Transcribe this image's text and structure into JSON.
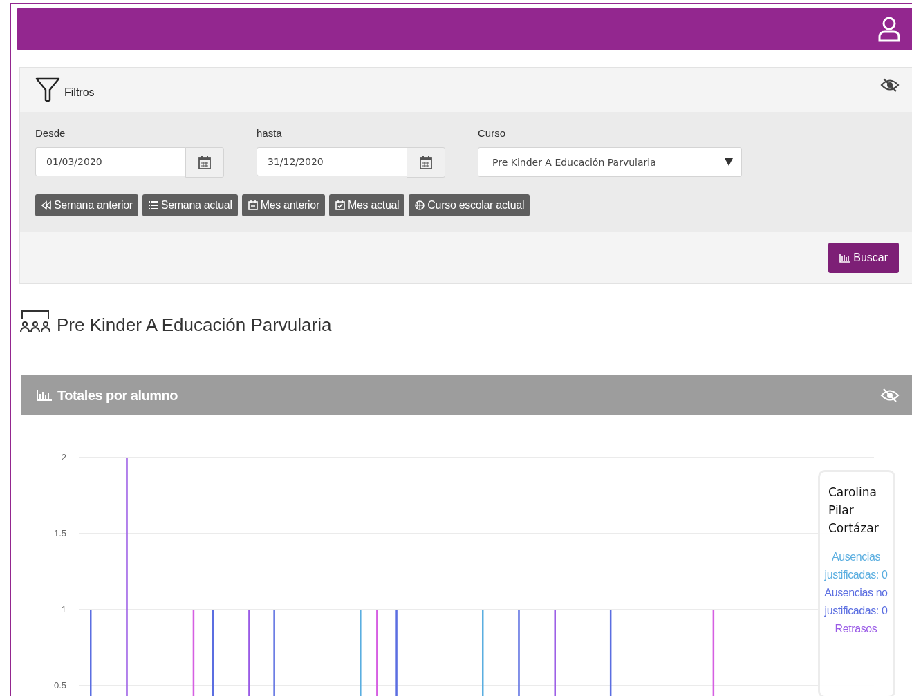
{
  "filters": {
    "title": "Filtros",
    "fields": [
      {
        "label": "Desde",
        "value": "01/03/2020",
        "kind": "date"
      },
      {
        "label": "hasta",
        "value": "31/12/2020",
        "kind": "date"
      },
      {
        "label": "Curso",
        "value": "Pre Kinder A Educación Parvularia",
        "kind": "select"
      }
    ],
    "quick_buttons": [
      "Semana anterior",
      "Semana actual",
      "Mes anterior",
      "Mes actual",
      "Curso escolar actual"
    ],
    "search_button": "Buscar"
  },
  "course_title": "Pre Kinder A Educación Parvularia",
  "chart_panel": {
    "title": "Totales por alumno",
    "chart_data": {
      "type": "bar",
      "grid": true,
      "ylim": [
        0,
        2
      ],
      "yticks": [
        {
          "value": 0.5,
          "label": "0.5"
        },
        {
          "value": 1,
          "label": "1"
        },
        {
          "value": 1.5,
          "label": "1.5"
        },
        {
          "value": 2,
          "label": "2"
        }
      ],
      "series": [
        {
          "name": "Ausencias justificadas",
          "color": "#5aaee0",
          "values": [
            0,
            0,
            0,
            0,
            0,
            0,
            0,
            0,
            0,
            1,
            0,
            0,
            0,
            1,
            0,
            0,
            0,
            0,
            0,
            0,
            0,
            0,
            0,
            0,
            0,
            0
          ]
        },
        {
          "name": "Ausencias no justificadas",
          "color": "#5b6ee1",
          "values": [
            1,
            0,
            0,
            0,
            1,
            0,
            1,
            0,
            0,
            0,
            1,
            0,
            0,
            0,
            1,
            0,
            0,
            1,
            0,
            0,
            0,
            0,
            0,
            0,
            0,
            0
          ]
        },
        {
          "name": "Retrasos",
          "color": "#9a5be6",
          "values": [
            0,
            2,
            0,
            0,
            0,
            1,
            0,
            0,
            0,
            0,
            0,
            0,
            0,
            0,
            0,
            1,
            0,
            0,
            0,
            0,
            0,
            0,
            0,
            0,
            0,
            0
          ]
        },
        {
          "color": "#d65fe2",
          "values": [
            0,
            0,
            0,
            1,
            0,
            0,
            0,
            0,
            0,
            1,
            0,
            0,
            0,
            0,
            0,
            0,
            0,
            0,
            0,
            0,
            1,
            0,
            0,
            0,
            0,
            0
          ]
        }
      ]
    },
    "tooltip": {
      "name": "Carolina Pilar Cortázar",
      "values": [
        ": 0",
        ": 0"
      ]
    }
  }
}
